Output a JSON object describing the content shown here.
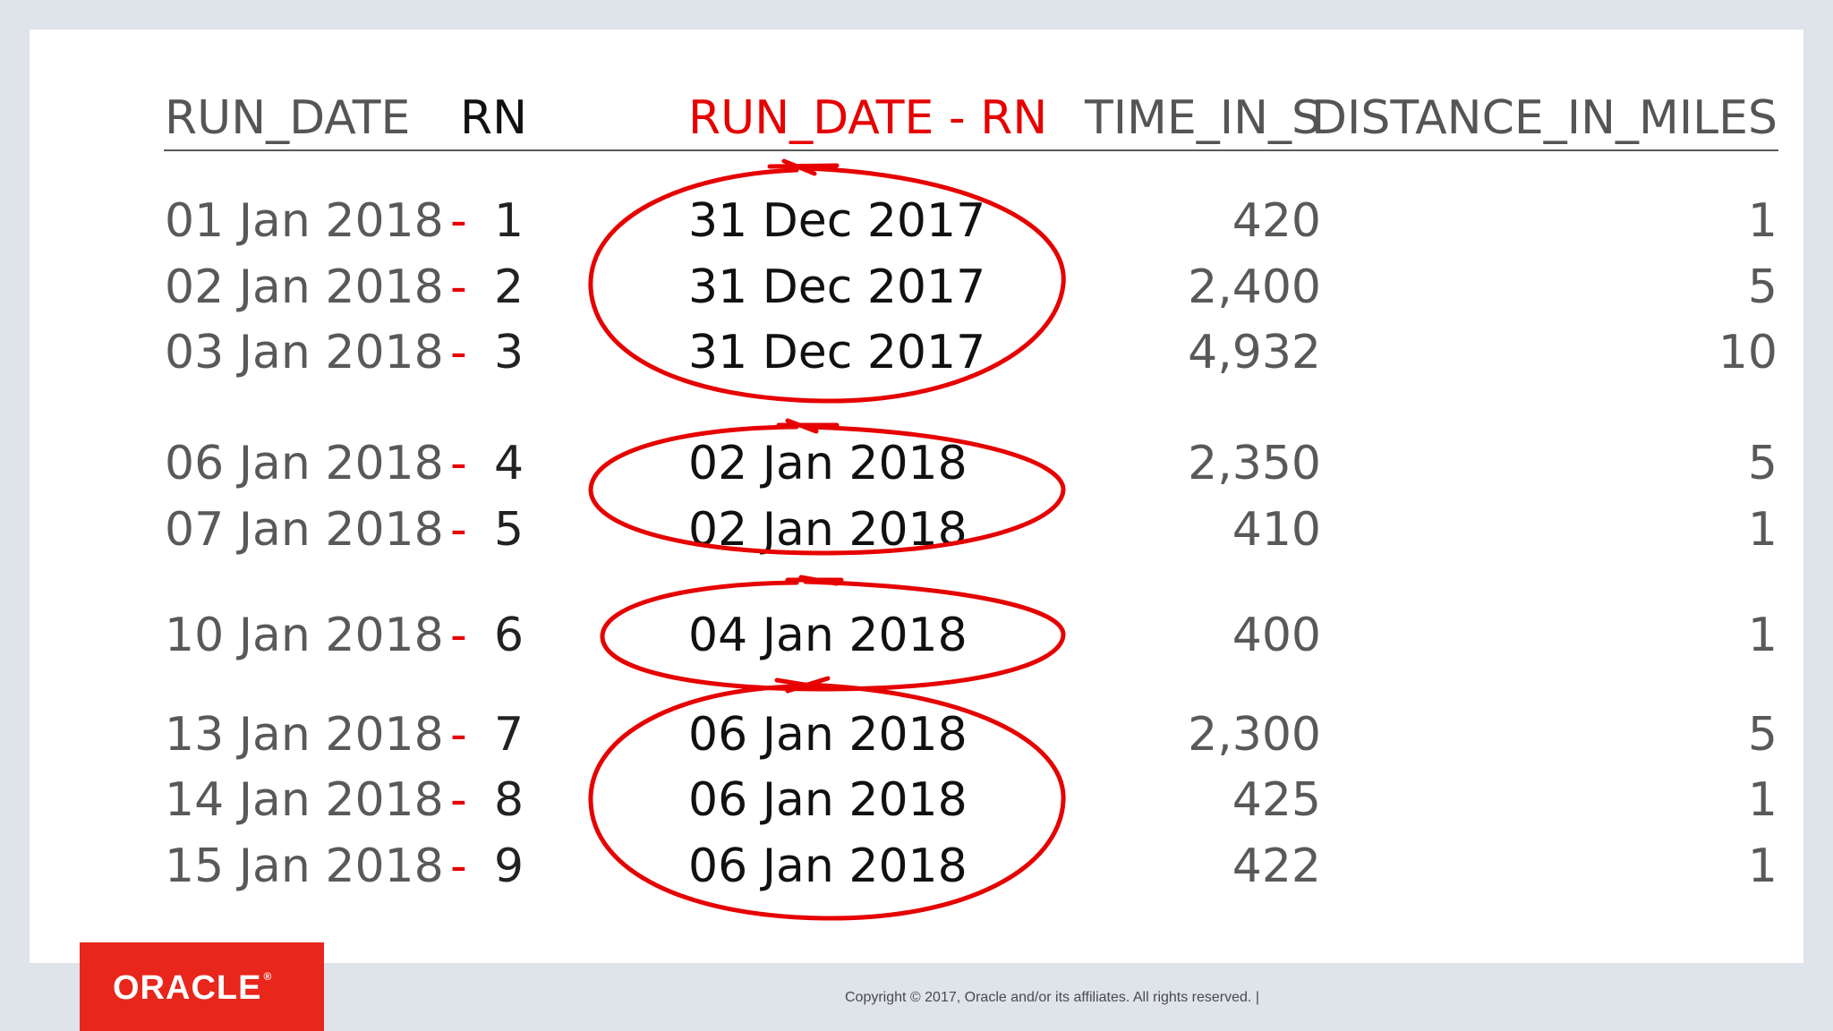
{
  "headers": {
    "run_date": "RUN_DATE",
    "rn": "RN",
    "diff": "RUN_DATE - RN",
    "time": "TIME_IN_S",
    "distance": "DISTANCE_IN_MILES"
  },
  "minus_sign": "-",
  "rows": [
    {
      "run_date": "01 Jan 2018",
      "rn": "1",
      "result": "31 Dec 2017",
      "time": "420",
      "distance": "1"
    },
    {
      "run_date": "02 Jan 2018",
      "rn": "2",
      "result": "31 Dec 2017",
      "time": "2,400",
      "distance": "5"
    },
    {
      "run_date": "03 Jan 2018",
      "rn": "3",
      "result": "31 Dec 2017",
      "time": "4,932",
      "distance": "10"
    },
    {
      "run_date": "06 Jan 2018",
      "rn": "4",
      "result": "02 Jan 2018",
      "time": "2,350",
      "distance": "5"
    },
    {
      "run_date": "07 Jan 2018",
      "rn": "5",
      "result": "02 Jan 2018",
      "time": "410",
      "distance": "1"
    },
    {
      "run_date": "10 Jan 2018",
      "rn": "6",
      "result": "04 Jan 2018",
      "time": "400",
      "distance": "1"
    },
    {
      "run_date": "13 Jan 2018",
      "rn": "7",
      "result": "06 Jan 2018",
      "time": "2,300",
      "distance": "5"
    },
    {
      "run_date": "14 Jan 2018",
      "rn": "8",
      "result": "06 Jan 2018",
      "time": "425",
      "distance": "1"
    },
    {
      "run_date": "15 Jan 2018",
      "rn": "9",
      "result": "06 Jan 2018",
      "time": "422",
      "distance": "1"
    }
  ],
  "logo": {
    "text": "ORACLE",
    "mark": "®"
  },
  "footer": "Copyright © 2017, Oracle and/or its affiliates. All rights reserved.  |",
  "colors": {
    "accent": "#e60000",
    "logo_bg": "#e8261b",
    "text": "#595959",
    "background": "#dfe3ea"
  }
}
